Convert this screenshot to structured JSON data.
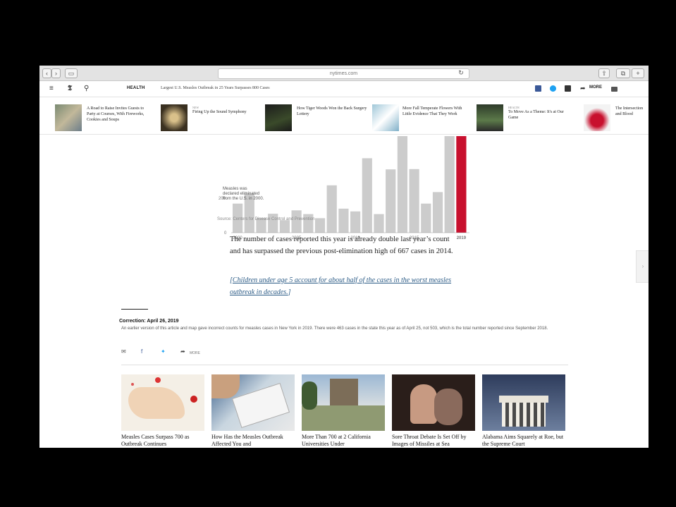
{
  "browser": {
    "url": "nytimes.com",
    "back": "‹",
    "forward": "›",
    "share": "⇧",
    "tabs": "⧉",
    "reload": "↻"
  },
  "header": {
    "menu_icon": "menu-icon",
    "section": "HEALTH",
    "headline": "Largest U.S. Measles Outbreak in 25 Years Surpasses 800 Cases",
    "more": "MORE"
  },
  "recommendations": [
    {
      "kicker": "",
      "text": "A Road to Raise Invites Guests to Party at Courses, With Fireworks, Cookies and Soups"
    },
    {
      "kicker": "NEW",
      "text": "Firing Up the Sound Symphony"
    },
    {
      "kicker": "",
      "text": "How Tiger Woods Won the Back Surgery Lottery"
    },
    {
      "kicker": "",
      "text": "More Fall Temperate Flowers With Little Evidence That They Work"
    },
    {
      "kicker": "HEALTH",
      "text": "To Move As a Theme: It's at Our Game"
    },
    {
      "kicker": "",
      "text": "The Intersection and Blood"
    }
  ],
  "chart_data": {
    "type": "bar",
    "title": "",
    "annotation": "Measles was declared eliminated from the U.S. in 2000.",
    "x_tick_labels": [
      "2000",
      "2005",
      "2010",
      "2015",
      "2019"
    ],
    "y_tick_labels": [
      "200",
      "0"
    ],
    "categories": [
      "2000",
      "2001",
      "2002",
      "2003",
      "2004",
      "2005",
      "2006",
      "2007",
      "2008",
      "2009",
      "2010",
      "2011",
      "2012",
      "2013",
      "2014",
      "2015",
      "2016",
      "2017",
      "2018",
      "2019"
    ],
    "values": [
      86,
      116,
      44,
      56,
      37,
      66,
      55,
      43,
      140,
      71,
      63,
      220,
      55,
      187,
      667,
      188,
      86,
      120,
      375,
      880
    ],
    "highlight_index": 19,
    "ylim": [
      0,
      400
    ],
    "colors": {
      "bar": "#cccccc",
      "highlight": "#c8102e"
    }
  },
  "chart_source": "Source: Centers for Disease Control and Prevention",
  "body": {
    "paragraph": "The number of cases reported this year is already double last year’s count and has surpassed the previous post-elimination high of 667 cases in 2014.",
    "link_open": "[",
    "link_text": "Children under age 5 account for about half of the cases in the worst measles outbreak in decades.",
    "link_close": "]"
  },
  "correction": {
    "title": "Correction: April 26, 2019",
    "text": "An earlier version of this article and map gave incorrect counts for measles cases in New York in 2019. There were 463 cases in the state this year as of April 25, not 503, which is the total number reported since September 2018."
  },
  "share": {
    "more": "MORE"
  },
  "cards": [
    {
      "title": "Measles Cases Surpass 700 as Outbreak Continues"
    },
    {
      "title": "How Has the Measles Outbreak Affected You and"
    },
    {
      "title": "More Than 700 at 2 California Universities Under"
    },
    {
      "title": "Sore Throat Debate Is Set Off by Images of Missiles at Sea"
    },
    {
      "title": "Alabama Aims Squarely at Roe, but the Supreme Court"
    }
  ]
}
